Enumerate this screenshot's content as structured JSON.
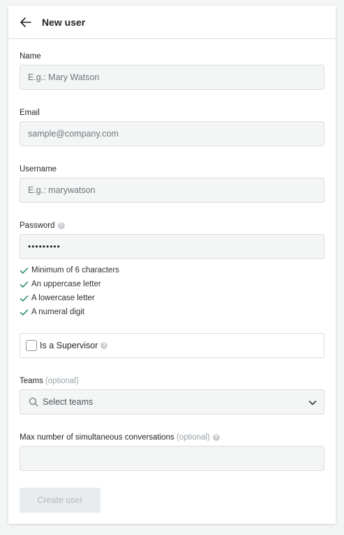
{
  "header": {
    "title": "New user"
  },
  "form": {
    "name": {
      "label": "Name",
      "placeholder": "E.g.: Mary Watson",
      "value": ""
    },
    "email": {
      "label": "Email",
      "placeholder": "sample@company.com",
      "value": ""
    },
    "username": {
      "label": "Username",
      "placeholder": "E.g.: marywatson",
      "value": ""
    },
    "password": {
      "label": "Password",
      "value": "•••••••••",
      "requirements": [
        "Minimum of 6 characters",
        "An uppercase letter",
        "A lowercase letter",
        "A numeral digit"
      ]
    },
    "supervisor": {
      "label": "Is a Supervisor",
      "checked": false
    },
    "teams": {
      "label": "Teams",
      "optional": "(optional)",
      "placeholder": "Select teams"
    },
    "max_conversations": {
      "label": "Max number of simultaneous conversations",
      "optional": "(optional)",
      "value": ""
    },
    "submit_label": "Create user"
  },
  "colors": {
    "check": "#1e8a5a",
    "input_bg": "#f4f5f5",
    "disabled_button_bg": "#e9ecee"
  },
  "icons": {
    "back": "arrow-left-icon",
    "help": "question-circle-icon",
    "check": "check-icon",
    "search": "search-icon",
    "dropdown": "chevron-down-icon"
  }
}
